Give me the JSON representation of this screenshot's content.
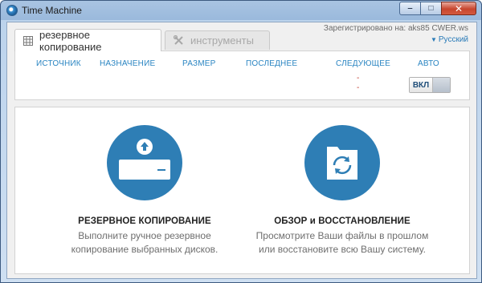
{
  "window": {
    "title": "Time Machine",
    "controls": {
      "minimize": "‒",
      "maximize": "□",
      "close": "✕"
    }
  },
  "header": {
    "registered": "Зарегистрировано на: aks85 CWER.ws",
    "language": "Русский"
  },
  "tabs": [
    {
      "label": "резервное копирование",
      "active": true,
      "icon": "grid-icon"
    },
    {
      "label": "инструменты",
      "active": false,
      "icon": "tools-icon"
    }
  ],
  "backup_columns": {
    "source": "ИСТОЧНИК",
    "destination": "НАЗНАЧЕНИЕ",
    "size": "РАЗМЕР",
    "last": "ПОСЛЕДНЕЕ",
    "next": "СЛЕДУЮЩЕЕ",
    "auto": "АВТО"
  },
  "backup_values": {
    "next_line1": "-",
    "next_line2": "-",
    "auto_toggle": "ВКЛ"
  },
  "actions": [
    {
      "heading": "РЕЗЕРВНОЕ КОПИРОВАНИЕ",
      "desc_line1": "Выполните ручное резервное",
      "desc_line2": "копирование выбранных дисков.",
      "icon": "backup-drive-icon"
    },
    {
      "heading_part1": "ОБЗОР",
      "heading_conj": "и",
      "heading_part2": "ВОССТАНОВЛЕНИЕ",
      "desc_line1": "Просмотрите Ваши файлы в прошлом",
      "desc_line2": "или восстановите всю Вашу систему.",
      "icon": "restore-folder-icon"
    }
  ],
  "colors": {
    "accent": "#2e7eb5",
    "header_blue": "#2a85c2",
    "dash_red": "#c0392b"
  }
}
